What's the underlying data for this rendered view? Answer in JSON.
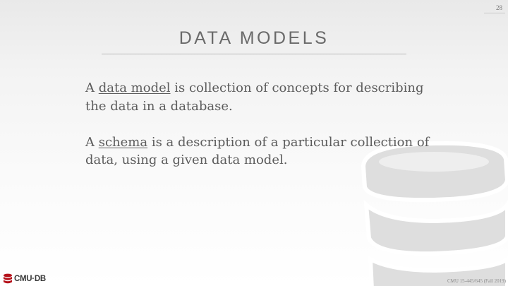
{
  "slide": {
    "page_number": "28",
    "title": "DATA MODELS",
    "paragraphs": [
      {
        "before": "A ",
        "term": "data model",
        "after": " is collection of concepts for describing the data in a database."
      },
      {
        "before": "A ",
        "term": "schema",
        "after": " is a description of a particular collection of data, using a given data model."
      }
    ],
    "logo_text": "CMU·DB",
    "footer": "CMU 15-445/645 (Fall 2019)"
  },
  "colors": {
    "logo_red": "#b5121b",
    "watermark": "#dedede"
  },
  "icons": [
    "database-watermark-icon",
    "cmu-db-logo-icon"
  ]
}
